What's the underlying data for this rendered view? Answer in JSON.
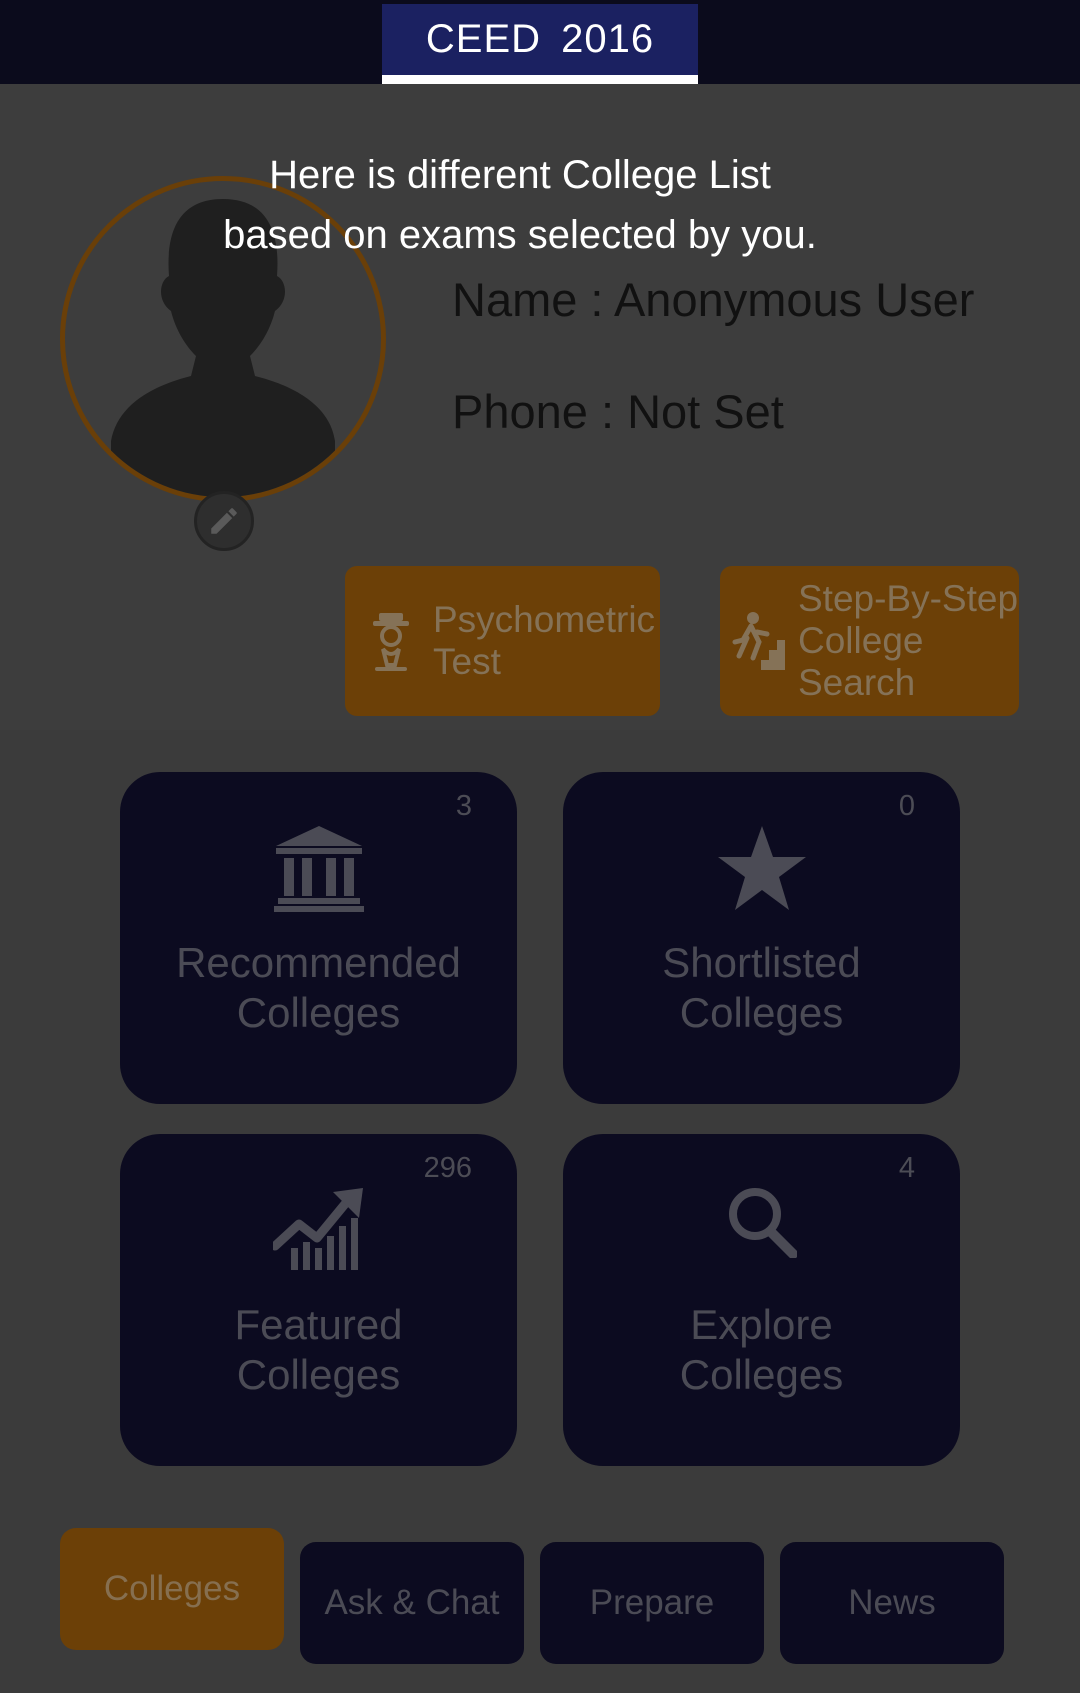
{
  "header": {
    "exam_label": "CEED  2016"
  },
  "tooltip": {
    "line1": "Here is different College List",
    "line2": "based on exams selected by you."
  },
  "profile": {
    "name_text": "Name : Anonymous User",
    "phone_text": "Phone : Not Set"
  },
  "actions": {
    "psychometric": {
      "line1": "Psychometric",
      "line2": "Test",
      "icon": "person-with-hat-icon"
    },
    "step_search": {
      "line1": "Step-By-Step",
      "line2": "College",
      "line3": "Search",
      "icon": "person-climbing-stairs-icon"
    }
  },
  "tiles": [
    {
      "count": "3",
      "line1": "Recommended",
      "line2": "Colleges",
      "icon": "institution-icon"
    },
    {
      "count": "0",
      "line1": "Shortlisted",
      "line2": "Colleges",
      "icon": "star-icon"
    },
    {
      "count": "296",
      "line1": "Featured",
      "line2": "Colleges",
      "icon": "trending-chart-icon"
    },
    {
      "count": "4",
      "line1": "Explore",
      "line2": "Colleges",
      "icon": "search-icon"
    }
  ],
  "bottom_nav": [
    {
      "label": "Colleges",
      "active": true
    },
    {
      "label": "Ask & Chat",
      "active": false
    },
    {
      "label": "Prepare",
      "active": false
    },
    {
      "label": "News",
      "active": false
    }
  ],
  "colors": {
    "overlay": "#3b3b3b",
    "accent_orange": "#6c4007",
    "tile_navy": "#0c0b20",
    "exam_tab": "#1b2161"
  }
}
